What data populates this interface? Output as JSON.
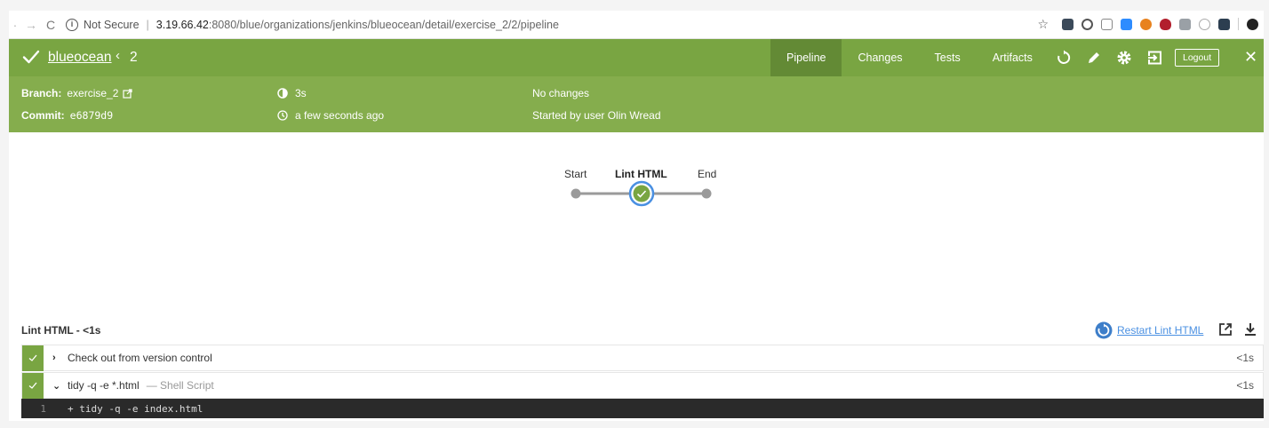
{
  "browser": {
    "security_label": "Not Secure",
    "url_host": "3.19.66.42",
    "url_path": ":8080/blue/organizations/jenkins/blueocean/detail/exercise_2/2/pipeline"
  },
  "header": {
    "pipeline_name": "blueocean",
    "run_number": "2",
    "tabs": [
      "Pipeline",
      "Changes",
      "Tests",
      "Artifacts"
    ],
    "active_tab": "Pipeline",
    "logout_label": "Logout"
  },
  "run_info": {
    "branch_label": "Branch:",
    "branch_value": "exercise_2",
    "commit_label": "Commit:",
    "commit_value": "e6879d9",
    "duration": "3s",
    "time_ago": "a few seconds ago",
    "changes": "No changes",
    "started_by": "Started by user Olin Wread"
  },
  "graph": {
    "nodes": [
      "Start",
      "Lint HTML",
      "End"
    ],
    "selected": "Lint HTML"
  },
  "steps_panel": {
    "title": "Lint HTML - ",
    "duration": "<1s",
    "restart_label": "Restart Lint HTML",
    "steps": [
      {
        "toggle": "›",
        "name": "Check out from version control",
        "sub": "",
        "duration": "<1s"
      },
      {
        "toggle": "⌄",
        "name": "tidy -q -e *.html",
        "sub": "— Shell Script",
        "duration": "<1s"
      }
    ],
    "log_line_number": "1",
    "log_text": "+ tidy -q -e index.html"
  },
  "colors": {
    "header": "#79a542",
    "subheader": "#85ad4d",
    "active_tab": "#638a35",
    "link": "#4a90e2",
    "log_bg": "#2a2a2a"
  }
}
